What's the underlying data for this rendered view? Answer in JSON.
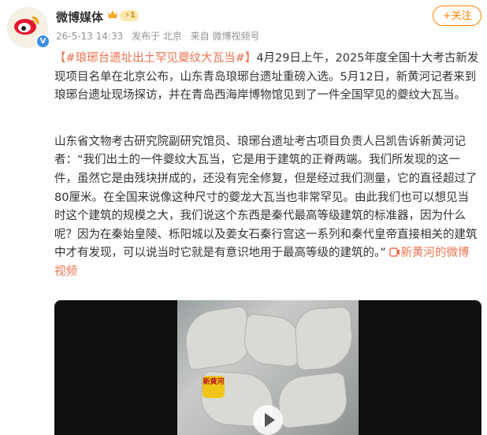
{
  "author": {
    "name": "微博媒体",
    "level": "1",
    "avatar_icon": "weibo-logo-icon"
  },
  "meta": {
    "time": "26-5-13 14:33",
    "location": "发布于 北京",
    "source": "来自 微博视频号"
  },
  "follow_label": "+关注",
  "post": {
    "hashtag": "【#琅琊台遗址出土罕见夔纹大瓦当#】",
    "para1_rest": "4月29日上午，2025年度全国十大考古新发现项目名单在北京公布，山东青岛琅琊台遗址重磅入选。5月12日，新黄河记者来到琅琊台遗址现场探访，并在青岛西海岸博物馆见到了一件全国罕见的夔纹大瓦当。",
    "para2": "山东省文物考古研究院副研究馆员、琅琊台遗址考古项目负责人吕凯告诉新黄河记者：“我们出土的一件夔纹大瓦当，它是用于建筑的正脊两端。我们所发现的这一件，虽然它是由残块拼成的，还没有完全修复，但是经过我们测量，它的直径超过了80厘米。在全国来说像这种尺寸的夔龙大瓦当也非常罕见。由此我们也可以想见当时这个建筑的规模之大，我们说这个东西是秦代最高等级建筑的标准器，因为什么呢？因为在秦始皇陵、栎阳城以及姜女石秦行宫这一系列和秦代皇帝直接相关的建筑中才有发现，可以说当时它就是有意识地用于最高等级的建筑的。”",
    "video_link": "新黄河的微博视频"
  },
  "video": {
    "watermark": "新黄河",
    "play_icon": "play-icon"
  },
  "colors": {
    "accent": "#ff8200",
    "link": "#eb7350",
    "meta": "#939393"
  }
}
